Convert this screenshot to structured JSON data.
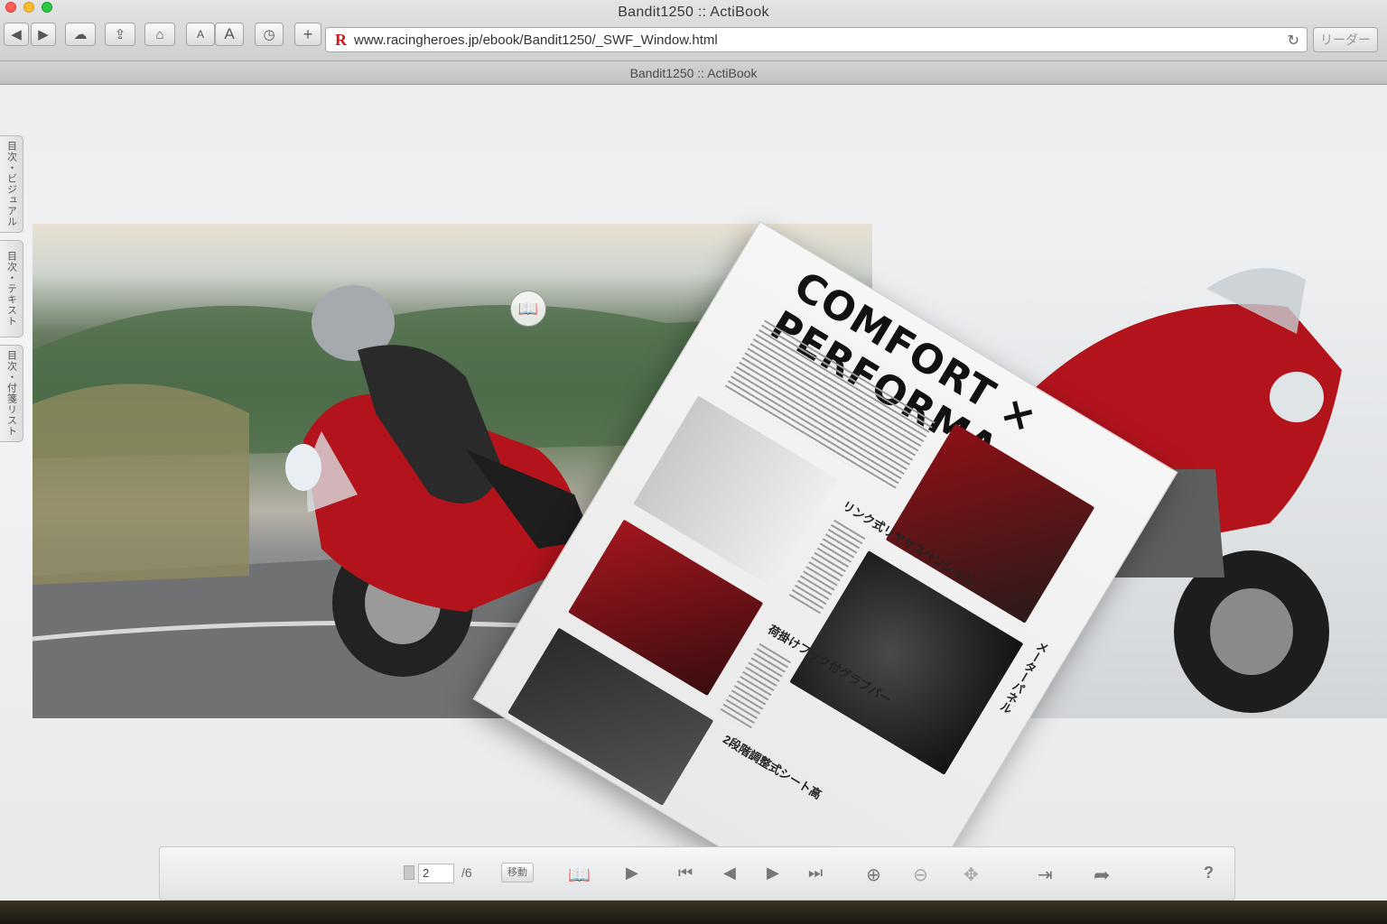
{
  "window": {
    "title": "Bandit1250 :: ActiBook",
    "traffic_colors": [
      "#ff5f57",
      "#febc2e",
      "#28c840"
    ]
  },
  "toolbar": {
    "back_icon": "chevron-left-icon",
    "forward_icon": "chevron-right-icon",
    "font_small": "A",
    "font_large": "A",
    "new_tab": "+"
  },
  "address_bar": {
    "url": "www.racingheroes.jp/ebook/Bandit1250/_SWF_Window.html",
    "reader_label": "リーダー"
  },
  "page_tab_title": "Bandit1250 :: ActiBook",
  "side_tabs": [
    {
      "label": "目次・ビジュアル"
    },
    {
      "label": "目次・テキスト"
    },
    {
      "label": "目次・付箋リスト"
    }
  ],
  "flip_page": {
    "headline": "COMFORT × PERFORMA",
    "sections": [
      {
        "title": "リンク式リヤサスペンション"
      },
      {
        "title": "メーターパネル"
      },
      {
        "title": "荷掛けフック付グラブバー"
      },
      {
        "title": "2段階調整式シート高"
      }
    ]
  },
  "controls": {
    "current_page": "2",
    "total_pages": "/6",
    "move_label": "移動",
    "help_label": "?"
  },
  "accent_colors": {
    "bike_red": "#b3141c",
    "url_logo": "#d0181f"
  }
}
